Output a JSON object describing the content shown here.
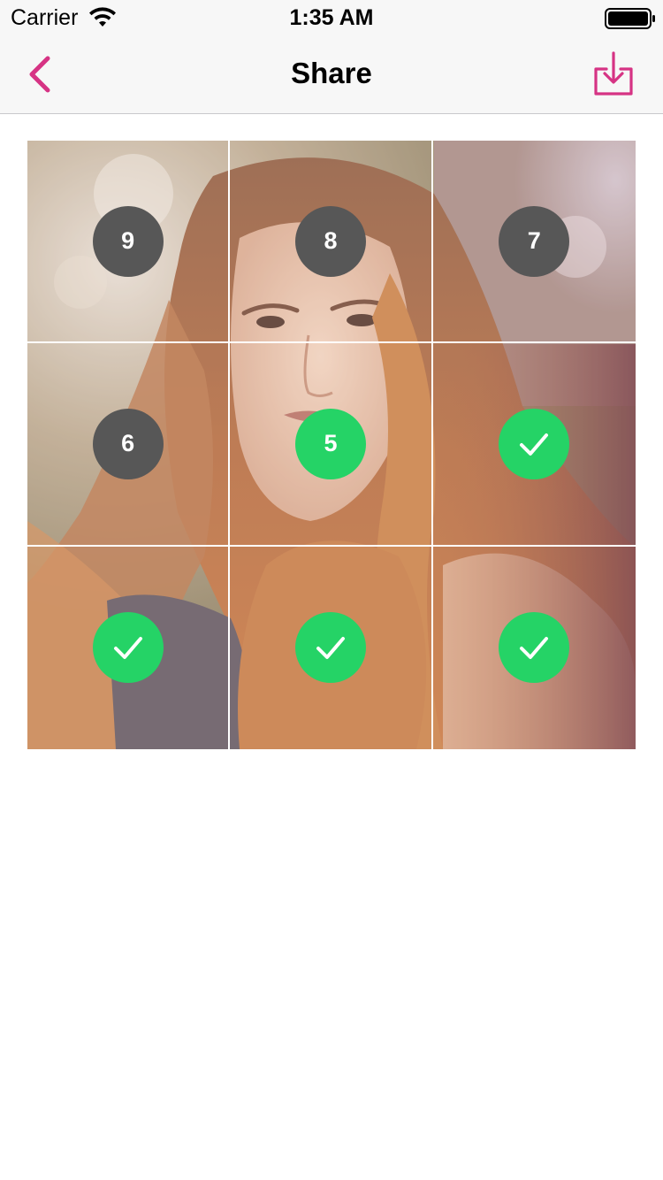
{
  "status_bar": {
    "carrier": "Carrier",
    "time": "1:35 AM"
  },
  "nav": {
    "title": "Share",
    "back_icon": "chevron-left-icon",
    "action_icon": "download-tray-icon",
    "accent_color": "#d63384"
  },
  "grid": {
    "cells": [
      {
        "state": "pending",
        "label": "9"
      },
      {
        "state": "pending",
        "label": "8"
      },
      {
        "state": "pending",
        "label": "7"
      },
      {
        "state": "pending",
        "label": "6"
      },
      {
        "state": "active",
        "label": "5"
      },
      {
        "state": "done",
        "label": ""
      },
      {
        "state": "done",
        "label": ""
      },
      {
        "state": "done",
        "label": ""
      },
      {
        "state": "done",
        "label": ""
      }
    ],
    "pending_color": "#575757",
    "done_color": "#25d366"
  }
}
